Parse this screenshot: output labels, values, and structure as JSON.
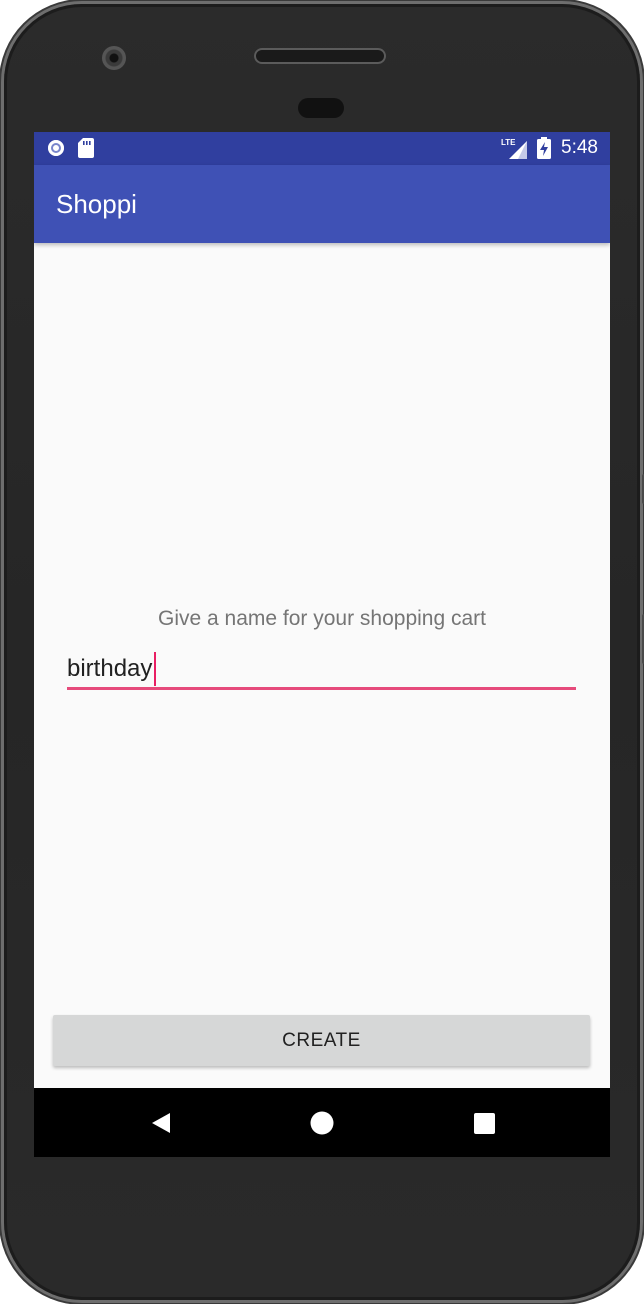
{
  "status_bar": {
    "network_label": "LTE",
    "time": "5:48"
  },
  "app_bar": {
    "title": "Shoppi"
  },
  "form": {
    "prompt": "Give a name for your shopping cart",
    "cart_name_value": "birthday"
  },
  "actions": {
    "create_label": "CREATE"
  },
  "nav_bar": {
    "icons": [
      "back-icon",
      "home-icon",
      "recents-icon"
    ]
  },
  "colors": {
    "status_bar": "#303f9f",
    "app_bar": "#3f51b5",
    "accent": "#e91e63",
    "background": "#fafafa",
    "button": "#d6d7d7"
  }
}
